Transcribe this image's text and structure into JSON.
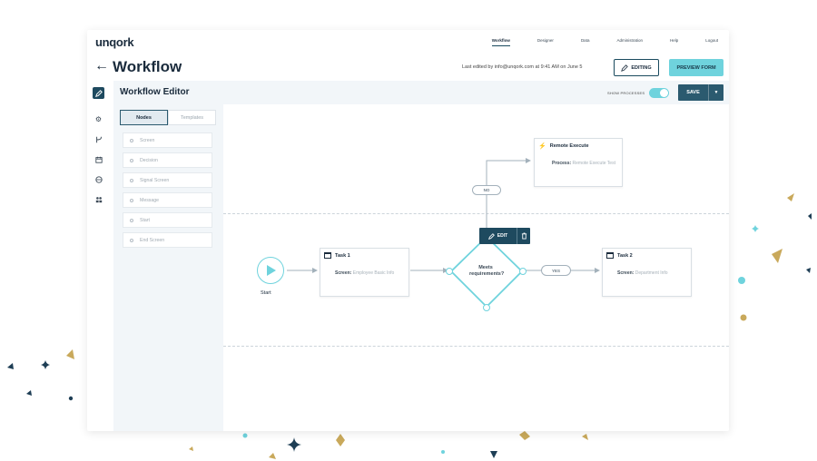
{
  "app": {
    "logo": "unqork",
    "nav": [
      "Workflow",
      "Designer",
      "Data",
      "Administration",
      "Help",
      "Logout"
    ],
    "active_nav": "Workflow",
    "page_title": "Workflow",
    "last_edited": "Last edited by info@unqork.com at 9:41 AM on June 5",
    "editing_label": "EDITING",
    "preview_label": "PREVIEW FORM"
  },
  "editor": {
    "title": "Workflow Editor",
    "show_processes": "SHOW PROCESSES",
    "show_processes_on": true,
    "save_label": "SAVE"
  },
  "palette": {
    "tabs": [
      "Nodes",
      "Templates"
    ],
    "active_tab": "Nodes",
    "items": [
      "Screen",
      "Decision",
      "Signal Screen",
      "Message",
      "Start",
      "End Screen"
    ]
  },
  "workflow": {
    "start_label": "Start",
    "task1": {
      "title": "Task 1",
      "key": "Screen:",
      "value": "Employee Basic Info"
    },
    "decision": {
      "label": "Meets requirements?",
      "edit": "EDIT"
    },
    "yes_label": "YES",
    "no_label": "NO",
    "task2": {
      "title": "Task 2",
      "key": "Screen:",
      "value": "Department Info"
    },
    "remote": {
      "title": "Remote Execute",
      "key": "Process:",
      "value": "Remote Execute Test"
    }
  },
  "colors": {
    "accent": "#6fd3dd",
    "navy": "#1e4a5f",
    "gold": "#c9a95b",
    "dark": "#1a2b3c"
  }
}
